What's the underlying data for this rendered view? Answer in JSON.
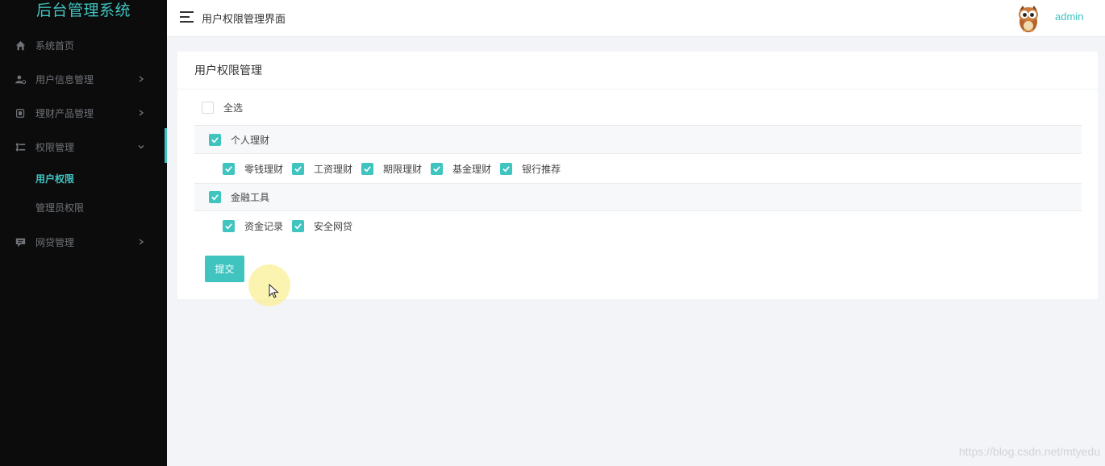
{
  "sidebar": {
    "brand": "后台管理系统",
    "items": [
      {
        "label": "系统首页",
        "icon": "home-icon"
      },
      {
        "label": "用户信息管理",
        "icon": "user-settings-icon"
      },
      {
        "label": "理财产品管理",
        "icon": "copy-icon"
      },
      {
        "label": "权限管理",
        "icon": "permission-icon",
        "expanded": true,
        "children": [
          {
            "label": "用户权限",
            "active": true
          },
          {
            "label": "管理员权限"
          }
        ]
      },
      {
        "label": "网贷管理",
        "icon": "message-icon"
      }
    ]
  },
  "header": {
    "title": "用户权限管理界面",
    "username": "admin",
    "avatar_icon": "owl-avatar"
  },
  "card": {
    "title": "用户权限管理",
    "select_all": {
      "label": "全选",
      "checked": false
    },
    "groups": [
      {
        "label": "个人理财",
        "checked": true,
        "children": [
          {
            "label": "零钱理财",
            "checked": true
          },
          {
            "label": "工资理财",
            "checked": true
          },
          {
            "label": "期限理财",
            "checked": true
          },
          {
            "label": "基金理财",
            "checked": true
          },
          {
            "label": "银行推荐",
            "checked": true
          }
        ]
      },
      {
        "label": "金融工具",
        "checked": true,
        "children": [
          {
            "label": "资金记录",
            "checked": true
          },
          {
            "label": "安全网贷",
            "checked": true
          }
        ]
      }
    ],
    "submit_label": "提交"
  },
  "watermark": "https://blog.csdn.net/mtyedu",
  "colors": {
    "accent": "#3fc4c0",
    "sidebar_bg": "#0c0c0c",
    "page_bg": "#f3f4f7"
  }
}
